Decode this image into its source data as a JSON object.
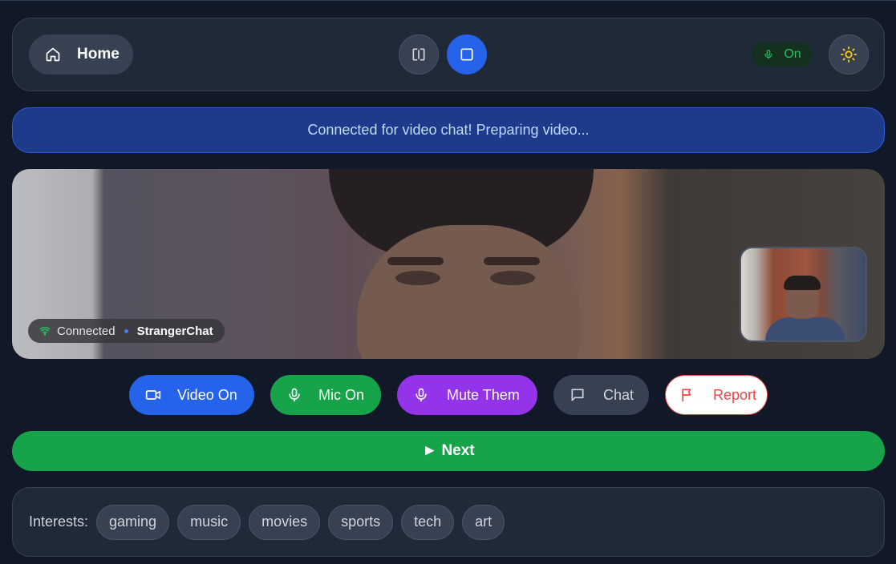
{
  "header": {
    "home_label": "Home",
    "mic_status_label": "On",
    "icons": {
      "home": "home-icon",
      "split_view": "split-view-icon",
      "single_view": "square-icon",
      "mic": "mic-icon",
      "theme": "sun-icon"
    }
  },
  "status_banner": "Connected for video chat! Preparing video...",
  "video": {
    "connection_status": "Connected",
    "brand": "StrangerChat"
  },
  "controls": {
    "video_on": "Video On",
    "mic_on": "Mic On",
    "mute_them": "Mute Them",
    "chat": "Chat",
    "report": "Report"
  },
  "next_label": "► Next",
  "interests": {
    "label": "Interests:",
    "tags": [
      "gaming",
      "music",
      "movies",
      "sports",
      "tech",
      "art"
    ]
  },
  "colors": {
    "background": "#111827",
    "panel": "#1f2937",
    "primary_blue": "#2563eb",
    "green": "#16a34a",
    "purple": "#9333ea",
    "report_red": "#ef4444",
    "sun_yellow": "#facc15"
  }
}
